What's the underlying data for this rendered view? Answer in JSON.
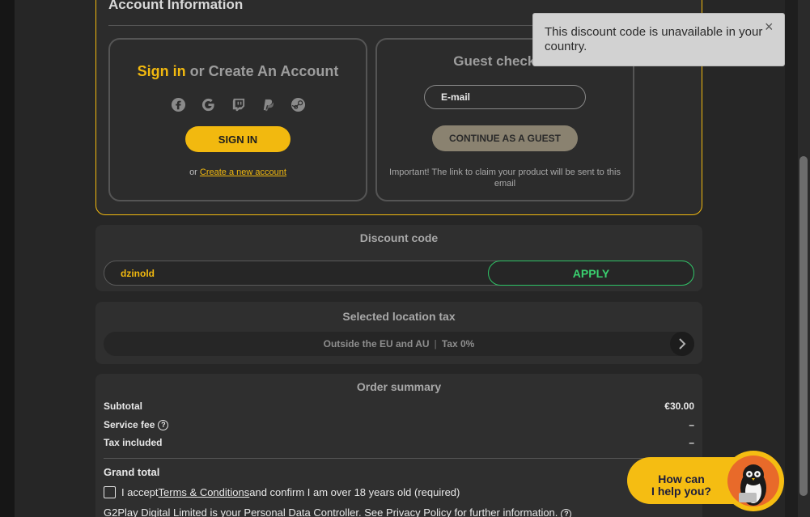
{
  "account": {
    "title": "Account Information",
    "signin": {
      "heading_highlight": "Sign in",
      "heading_rest": " or Create An Account",
      "social_icons": [
        "facebook-icon",
        "google-icon",
        "twitch-icon",
        "paypal-icon",
        "steam-icon"
      ],
      "button_label": "SIGN IN",
      "create_prefix": "or ",
      "create_link": "Create a new account"
    },
    "guest": {
      "heading": "Guest checkout",
      "email_placeholder": "E-mail",
      "button_label": "CONTINUE AS A GUEST",
      "note": "Important! The link to claim your product will be sent to this email"
    }
  },
  "toast": {
    "message": "This discount code is unavailable in your country.",
    "close_symbol": "×"
  },
  "discount": {
    "title": "Discount code",
    "code_value": "dzinold",
    "apply_label": "APPLY"
  },
  "tax": {
    "title": "Selected location tax",
    "location": "Outside the EU and AU",
    "separator": "|",
    "rate": "Tax 0%"
  },
  "order": {
    "title": "Order summary",
    "rows": [
      {
        "label": "Subtotal",
        "value": "€30.00"
      },
      {
        "label": "Service fee",
        "value": "–"
      },
      {
        "label": "Tax included",
        "value": "–"
      }
    ],
    "grand_total_label": "Grand total"
  },
  "terms": {
    "prefix": "I accept ",
    "link": "Terms & Conditions",
    "suffix": " and confirm I am over 18 years old (required)"
  },
  "controller_line": "G2Play Digital Limited is your Personal Data Controller. See Privacy Policy for further information.",
  "chat": {
    "line1": "How can",
    "line2": "I help you?"
  },
  "colors": {
    "accent": "#f2b90f",
    "apply_green": "#3ad06f",
    "toast_bg": "#d2d2d2"
  }
}
